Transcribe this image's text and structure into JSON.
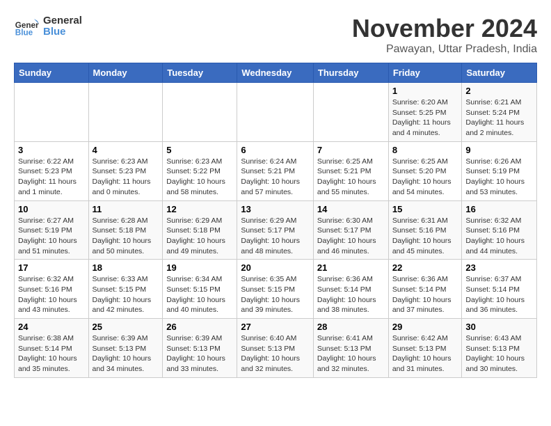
{
  "logo": {
    "text_general": "General",
    "text_blue": "Blue"
  },
  "title": "November 2024",
  "subtitle": "Pawayan, Uttar Pradesh, India",
  "headers": [
    "Sunday",
    "Monday",
    "Tuesday",
    "Wednesday",
    "Thursday",
    "Friday",
    "Saturday"
  ],
  "weeks": [
    [
      {
        "day": "",
        "info": ""
      },
      {
        "day": "",
        "info": ""
      },
      {
        "day": "",
        "info": ""
      },
      {
        "day": "",
        "info": ""
      },
      {
        "day": "",
        "info": ""
      },
      {
        "day": "1",
        "info": "Sunrise: 6:20 AM\nSunset: 5:25 PM\nDaylight: 11 hours and 4 minutes."
      },
      {
        "day": "2",
        "info": "Sunrise: 6:21 AM\nSunset: 5:24 PM\nDaylight: 11 hours and 2 minutes."
      }
    ],
    [
      {
        "day": "3",
        "info": "Sunrise: 6:22 AM\nSunset: 5:23 PM\nDaylight: 11 hours and 1 minute."
      },
      {
        "day": "4",
        "info": "Sunrise: 6:23 AM\nSunset: 5:23 PM\nDaylight: 11 hours and 0 minutes."
      },
      {
        "day": "5",
        "info": "Sunrise: 6:23 AM\nSunset: 5:22 PM\nDaylight: 10 hours and 58 minutes."
      },
      {
        "day": "6",
        "info": "Sunrise: 6:24 AM\nSunset: 5:21 PM\nDaylight: 10 hours and 57 minutes."
      },
      {
        "day": "7",
        "info": "Sunrise: 6:25 AM\nSunset: 5:21 PM\nDaylight: 10 hours and 55 minutes."
      },
      {
        "day": "8",
        "info": "Sunrise: 6:25 AM\nSunset: 5:20 PM\nDaylight: 10 hours and 54 minutes."
      },
      {
        "day": "9",
        "info": "Sunrise: 6:26 AM\nSunset: 5:19 PM\nDaylight: 10 hours and 53 minutes."
      }
    ],
    [
      {
        "day": "10",
        "info": "Sunrise: 6:27 AM\nSunset: 5:19 PM\nDaylight: 10 hours and 51 minutes."
      },
      {
        "day": "11",
        "info": "Sunrise: 6:28 AM\nSunset: 5:18 PM\nDaylight: 10 hours and 50 minutes."
      },
      {
        "day": "12",
        "info": "Sunrise: 6:29 AM\nSunset: 5:18 PM\nDaylight: 10 hours and 49 minutes."
      },
      {
        "day": "13",
        "info": "Sunrise: 6:29 AM\nSunset: 5:17 PM\nDaylight: 10 hours and 48 minutes."
      },
      {
        "day": "14",
        "info": "Sunrise: 6:30 AM\nSunset: 5:17 PM\nDaylight: 10 hours and 46 minutes."
      },
      {
        "day": "15",
        "info": "Sunrise: 6:31 AM\nSunset: 5:16 PM\nDaylight: 10 hours and 45 minutes."
      },
      {
        "day": "16",
        "info": "Sunrise: 6:32 AM\nSunset: 5:16 PM\nDaylight: 10 hours and 44 minutes."
      }
    ],
    [
      {
        "day": "17",
        "info": "Sunrise: 6:32 AM\nSunset: 5:16 PM\nDaylight: 10 hours and 43 minutes."
      },
      {
        "day": "18",
        "info": "Sunrise: 6:33 AM\nSunset: 5:15 PM\nDaylight: 10 hours and 42 minutes."
      },
      {
        "day": "19",
        "info": "Sunrise: 6:34 AM\nSunset: 5:15 PM\nDaylight: 10 hours and 40 minutes."
      },
      {
        "day": "20",
        "info": "Sunrise: 6:35 AM\nSunset: 5:15 PM\nDaylight: 10 hours and 39 minutes."
      },
      {
        "day": "21",
        "info": "Sunrise: 6:36 AM\nSunset: 5:14 PM\nDaylight: 10 hours and 38 minutes."
      },
      {
        "day": "22",
        "info": "Sunrise: 6:36 AM\nSunset: 5:14 PM\nDaylight: 10 hours and 37 minutes."
      },
      {
        "day": "23",
        "info": "Sunrise: 6:37 AM\nSunset: 5:14 PM\nDaylight: 10 hours and 36 minutes."
      }
    ],
    [
      {
        "day": "24",
        "info": "Sunrise: 6:38 AM\nSunset: 5:14 PM\nDaylight: 10 hours and 35 minutes."
      },
      {
        "day": "25",
        "info": "Sunrise: 6:39 AM\nSunset: 5:13 PM\nDaylight: 10 hours and 34 minutes."
      },
      {
        "day": "26",
        "info": "Sunrise: 6:39 AM\nSunset: 5:13 PM\nDaylight: 10 hours and 33 minutes."
      },
      {
        "day": "27",
        "info": "Sunrise: 6:40 AM\nSunset: 5:13 PM\nDaylight: 10 hours and 32 minutes."
      },
      {
        "day": "28",
        "info": "Sunrise: 6:41 AM\nSunset: 5:13 PM\nDaylight: 10 hours and 32 minutes."
      },
      {
        "day": "29",
        "info": "Sunrise: 6:42 AM\nSunset: 5:13 PM\nDaylight: 10 hours and 31 minutes."
      },
      {
        "day": "30",
        "info": "Sunrise: 6:43 AM\nSunset: 5:13 PM\nDaylight: 10 hours and 30 minutes."
      }
    ]
  ]
}
